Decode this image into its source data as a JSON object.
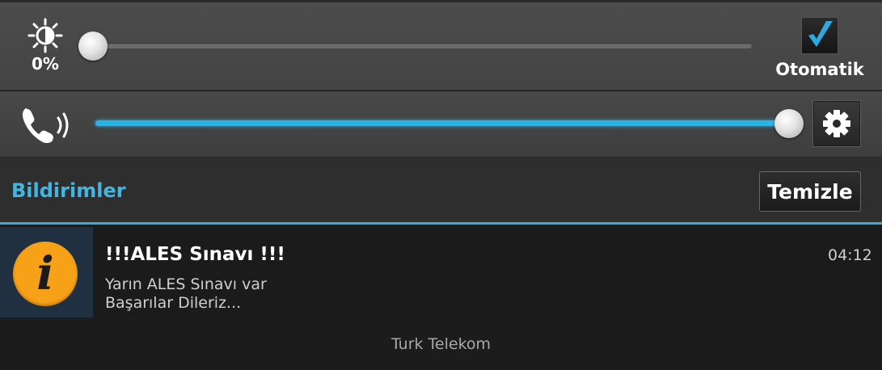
{
  "brightness": {
    "icon": "brightness-icon",
    "value_label": "0%",
    "level": 0,
    "auto_checked": true,
    "auto_label": "Otomatik"
  },
  "volume": {
    "icon": "phone-ringer-icon",
    "level": 1.0,
    "settings_icon": "gear-icon"
  },
  "notifications": {
    "title": "Bildirimler",
    "clear_label": "Temizle",
    "items": [
      {
        "icon": "info-icon",
        "title": "!!!ALES Sınavı !!!",
        "line1": "Yarın ALES Sınavı var",
        "line2": "Başarılar Dileriz...",
        "time": "04:12"
      }
    ]
  },
  "carrier": "Turk Telekom",
  "colors": {
    "accent": "#29b4e8",
    "header_text": "#42b6e3",
    "info_icon": "#f6a117"
  }
}
